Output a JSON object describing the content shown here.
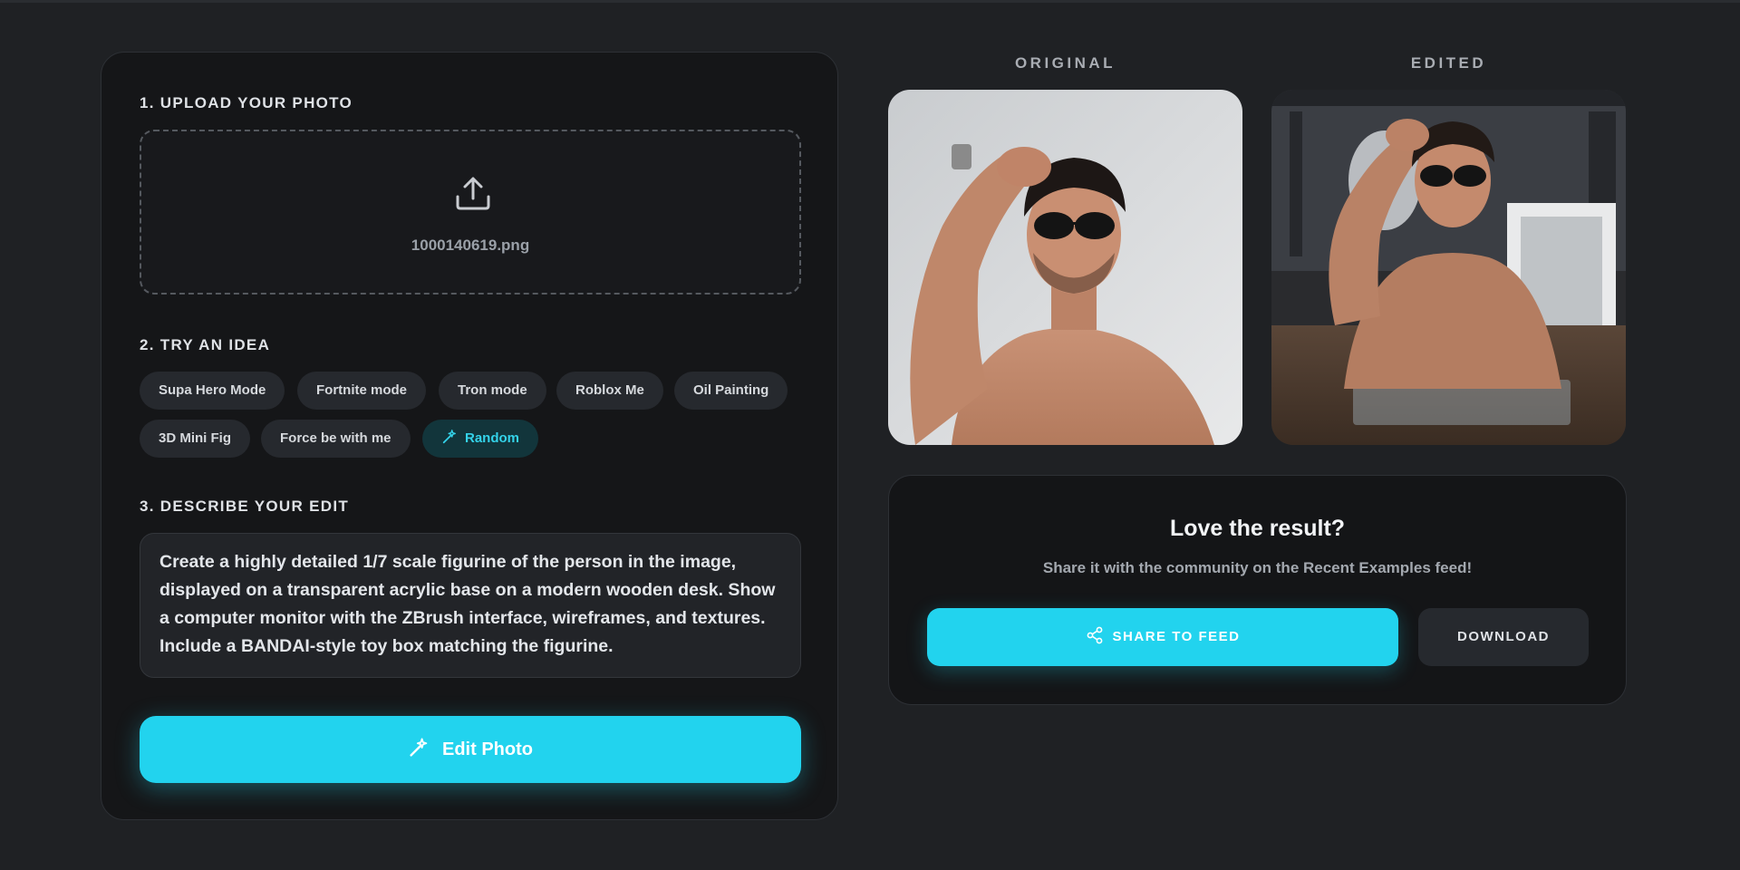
{
  "steps": {
    "upload": {
      "title": "1. UPLOAD YOUR PHOTO",
      "filename": "1000140619.png",
      "icon": "upload-icon"
    },
    "ideas": {
      "title": "2. TRY AN IDEA",
      "chips": [
        "Supa Hero Mode",
        "Fortnite mode",
        "Tron mode",
        "Roblox Me",
        "Oil Painting",
        "3D Mini Fig",
        "Force be with me",
        "Random"
      ]
    },
    "describe": {
      "title": "3. DESCRIBE YOUR EDIT",
      "prompt": "Create a highly detailed 1/7 scale figurine of the person in the image, displayed on a transparent acrylic base on a modern wooden desk. Show a computer monitor with the ZBrush interface, wireframes, and textures. Include a BANDAI-style toy box matching the figurine."
    },
    "edit_button": "Edit Photo"
  },
  "compare": {
    "original_label": "ORIGINAL",
    "edited_label": "EDITED"
  },
  "share": {
    "heading": "Love the result?",
    "subtext": "Share it with the community on the Recent Examples feed!",
    "share_button": "SHARE TO FEED",
    "download_button": "DOWNLOAD"
  },
  "colors": {
    "accent": "#22d3ee",
    "background": "#1f2124",
    "panel": "#151618",
    "chip": "#26292e"
  }
}
